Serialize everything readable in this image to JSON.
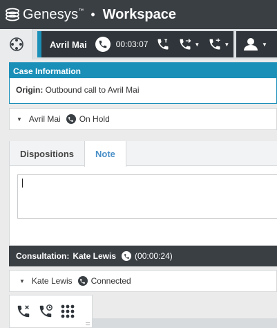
{
  "titlebar": {
    "brand": "Genesys",
    "brand_mark": "™",
    "separator": "•",
    "app": "Workspace"
  },
  "toolbar": {
    "status_icon": "target-circle-icon",
    "call": {
      "caller": "Avril Mai",
      "timer": "00:03:07",
      "accent_color": "#1a8fb8"
    },
    "buttons": [
      "phone-end-icon",
      "phone-transfer-icon",
      "phone-consult-icon",
      "agent-status-icon"
    ]
  },
  "case": {
    "header": "Case Information",
    "origin_label": "Origin:",
    "origin_value": "Outbound call to Avril Mai"
  },
  "party": {
    "name": "Avril Mai",
    "state": "On Hold"
  },
  "tabs": [
    {
      "label": "Dispositions",
      "active": false
    },
    {
      "label": "Note",
      "active": true
    }
  ],
  "note": {
    "value": ""
  },
  "consultation": {
    "label": "Consultation:",
    "name": "Kate Lewis",
    "duration": "(00:00:24)"
  },
  "party2": {
    "name": "Kate Lewis",
    "state": "Connected"
  },
  "actions": [
    "end-consult-icon",
    "hold-consult-icon",
    "dialpad-icon"
  ]
}
